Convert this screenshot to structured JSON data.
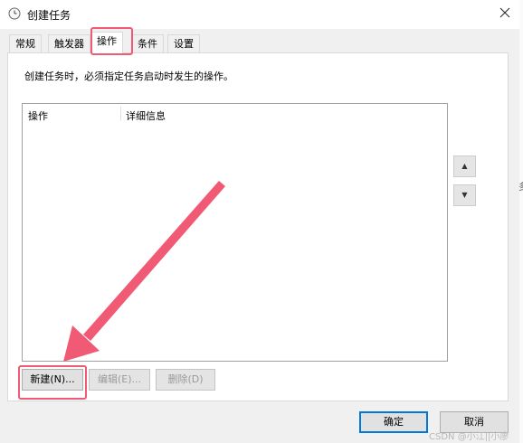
{
  "window": {
    "title": "创建任务",
    "icon": "clock-icon",
    "close_symbol": "✕"
  },
  "tabs": [
    {
      "label": "常规",
      "active": false
    },
    {
      "label": "触发器",
      "active": false
    },
    {
      "label": "操作",
      "active": true
    },
    {
      "label": "条件",
      "active": false
    },
    {
      "label": "设置",
      "active": false
    }
  ],
  "panel": {
    "description": "创建任务时，必须指定任务启动时发生的操作。",
    "columns": [
      "操作",
      "详细信息"
    ],
    "move_up_symbol": "▲",
    "move_down_symbol": "▼"
  },
  "actions": {
    "new_label": "新建(N)...",
    "edit_label": "编辑(E)...",
    "delete_label": "删除(D)"
  },
  "footer": {
    "ok_label": "确定",
    "cancel_label": "取消"
  },
  "edge": {
    "right_char": "多"
  },
  "watermark": "CSDN @小江||小廖",
  "colors": {
    "annotation": "#f15a74",
    "focus_border": "#0078d7"
  }
}
